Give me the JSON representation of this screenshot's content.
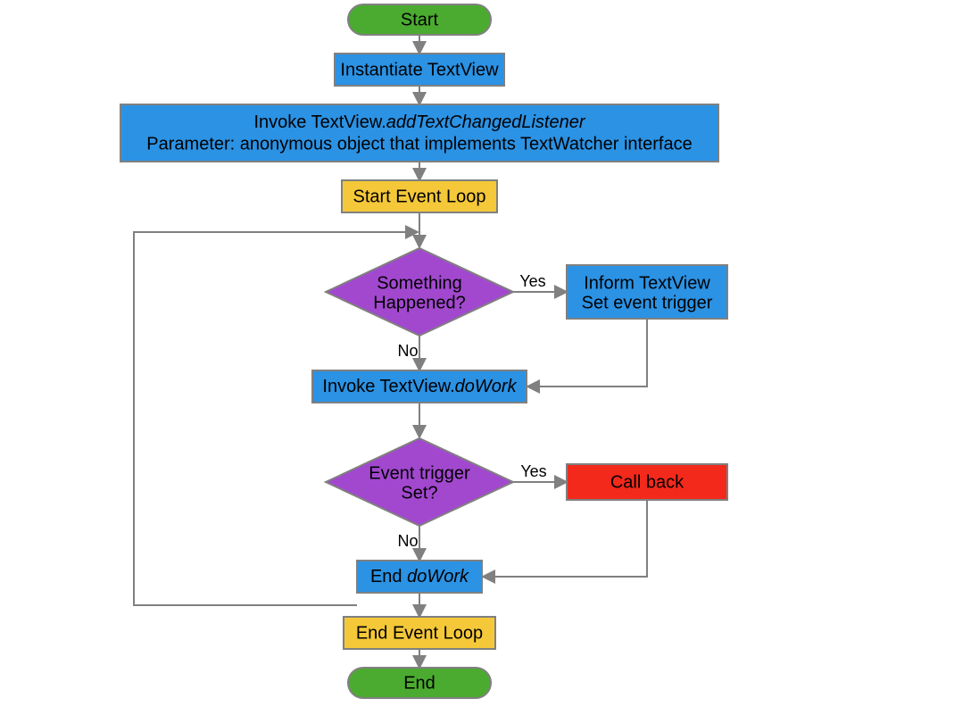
{
  "nodes": {
    "start": "Start",
    "instantiate": "Instantiate TextView",
    "invoke_line1_a": "Invoke TextView.",
    "invoke_line1_b": "addTextChangedListener",
    "invoke_line2": "Parameter: anonymous object that implements TextWatcher interface",
    "start_loop": "Start Event Loop",
    "something_l1": "Something",
    "something_l2": "Happened?",
    "inform_l1": "Inform TextView",
    "inform_l2": "Set event trigger",
    "dowork_a": "Invoke TextView.",
    "dowork_b": "doWork",
    "trigger_l1": "Event trigger",
    "trigger_l2": "Set?",
    "callback": "Call back",
    "end_dowork_a": "End ",
    "end_dowork_b": "doWork",
    "end_loop": "End Event Loop",
    "end": "End"
  },
  "labels": {
    "yes1": "Yes",
    "no1": "No",
    "yes2": "Yes",
    "no2": "No"
  }
}
